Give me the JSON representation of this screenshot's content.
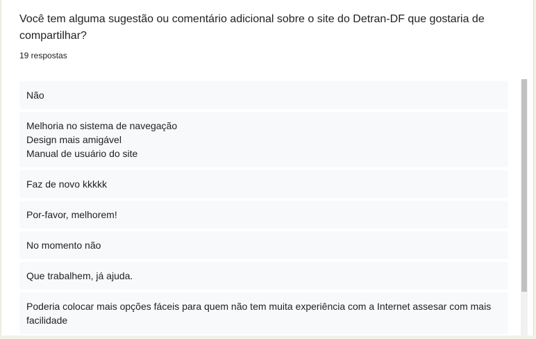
{
  "question": {
    "title": "Você tem alguma sugestão ou comentário adicional sobre o site do Detran-DF que gostaria de compartilhar?",
    "response_count": "19 respostas"
  },
  "responses": [
    "Não",
    "Melhoria no sistema de navegação\nDesign mais amigável\nManual de usuário do site",
    "Faz de novo kkkkk",
    "Por-favor, melhorem!",
    "No momento não",
    "Que trabalhem, já ajuda.",
    "Poderia colocar mais opções fáceis para quem não tem muita experiência com a Internet assesar com mais facilidade"
  ],
  "scrollbar": {
    "visible_fraction": 0.83
  }
}
